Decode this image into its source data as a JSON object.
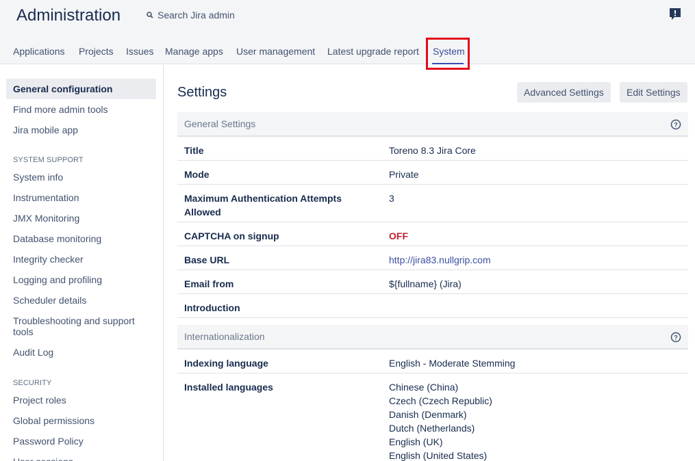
{
  "header": {
    "title": "Administration",
    "search_placeholder": "Search Jira admin",
    "feedback_icon": "feedback-icon"
  },
  "tabs": [
    {
      "label": "Applications"
    },
    {
      "label": "Projects"
    },
    {
      "label": "Issues"
    },
    {
      "label": "Manage apps"
    },
    {
      "label": "User management"
    },
    {
      "label": "Latest upgrade report"
    },
    {
      "label": "System",
      "active": true
    }
  ],
  "sidebar": {
    "top_items": [
      "General configuration",
      "Find more admin tools",
      "Jira mobile app"
    ],
    "system_support_heading": "SYSTEM SUPPORT",
    "system_support_items": [
      "System info",
      "Instrumentation",
      "JMX Monitoring",
      "Database monitoring",
      "Integrity checker",
      "Logging and profiling",
      "Scheduler details",
      "Troubleshooting and support tools",
      "Audit Log"
    ],
    "security_heading": "SECURITY",
    "security_items": [
      "Project roles",
      "Global permissions",
      "Password Policy",
      "User sessions"
    ]
  },
  "main": {
    "title": "Settings",
    "advanced_button": "Advanced Settings",
    "edit_button": "Edit Settings",
    "general": {
      "heading": "General Settings",
      "rows": [
        {
          "label": "Title",
          "value": "Toreno 8.3 Jira Core"
        },
        {
          "label": "Mode",
          "value": "Private"
        },
        {
          "label": "Maximum Authentication Attempts Allowed",
          "value": "3"
        },
        {
          "label": "CAPTCHA on signup",
          "value": "OFF"
        },
        {
          "label": "Base URL",
          "value": "http://jira83.nullgrip.com"
        },
        {
          "label": "Email from",
          "value": "${fullname} (Jira)"
        },
        {
          "label": "Introduction",
          "value": ""
        }
      ]
    },
    "i18n": {
      "heading": "Internationalization",
      "rows": [
        {
          "label": "Indexing language",
          "value": "English - Moderate Stemming"
        },
        {
          "label": "Installed languages",
          "values": [
            "Chinese (China)",
            "Czech (Czech Republic)",
            "Danish (Denmark)",
            "Dutch (Netherlands)",
            "English (UK)",
            "English (United States)"
          ]
        }
      ]
    }
  },
  "colors": {
    "accent": "#3b4bb0",
    "highlight_box": "#e20a1a",
    "off_value": "#bf1f2b",
    "link": "#3b4fa0"
  }
}
